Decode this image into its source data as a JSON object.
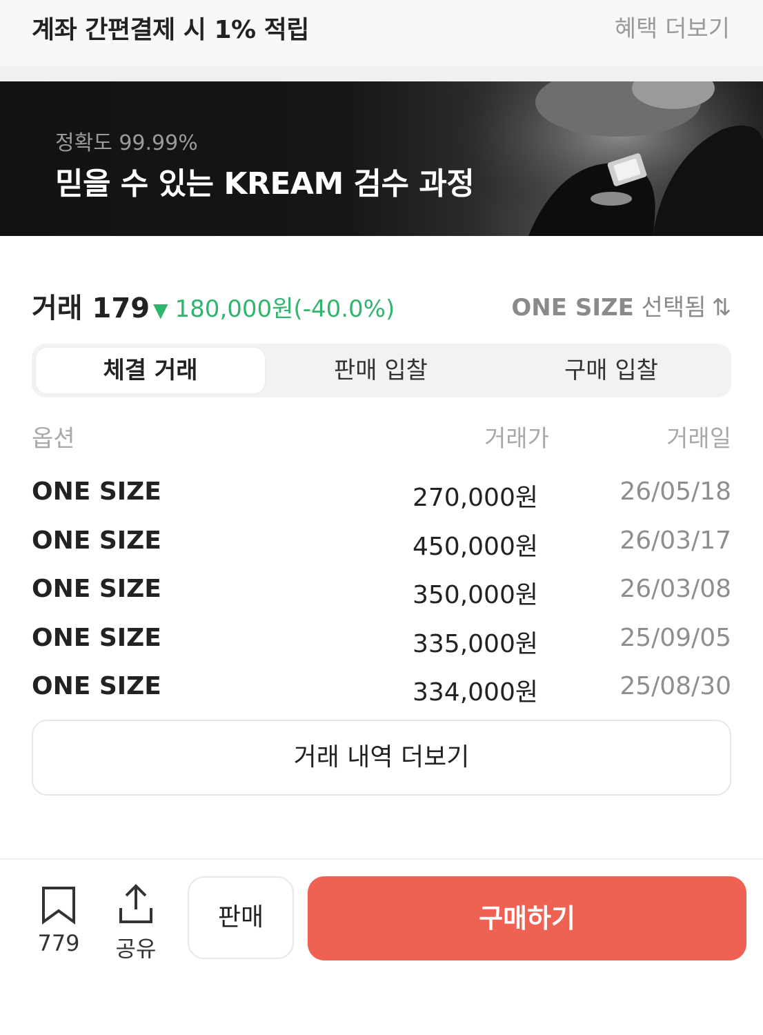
{
  "promo": {
    "text": "계좌 간편결제 시 1% 적립",
    "link": "혜택 더보기"
  },
  "banner": {
    "subtitle": "정확도 99.99%",
    "title": "믿을 수 있는 KREAM 검수 과정"
  },
  "trade": {
    "title": "거래 179",
    "change_arrow": "▼",
    "change": "180,000원(-40.0%)",
    "change_color": "#31b46e",
    "size_selected": "ONE SIZE",
    "size_suffix": "선택됨",
    "sort_icon": "⇅"
  },
  "tabs": [
    {
      "label": "체결 거래",
      "active": true
    },
    {
      "label": "판매 입찰",
      "active": false
    },
    {
      "label": "구매 입찰",
      "active": false
    }
  ],
  "table": {
    "headers": {
      "option": "옵션",
      "price": "거래가",
      "date": "거래일"
    },
    "rows": [
      {
        "option": "ONE SIZE",
        "price": "270,000원",
        "date": "26/05/18"
      },
      {
        "option": "ONE SIZE",
        "price": "450,000원",
        "date": "26/03/17"
      },
      {
        "option": "ONE SIZE",
        "price": "350,000원",
        "date": "26/03/08"
      },
      {
        "option": "ONE SIZE",
        "price": "335,000원",
        "date": "25/09/05"
      },
      {
        "option": "ONE SIZE",
        "price": "334,000원",
        "date": "25/08/30"
      }
    ]
  },
  "more_button": "거래 내역 더보기",
  "bottom_bar": {
    "bookmark_icon": "bookmark-icon",
    "bookmark_count": "779",
    "share_icon": "share-icon",
    "share_label": "공유",
    "sell_label": "판매",
    "buy_label": "구매하기",
    "buy_color": "#ef6253"
  }
}
